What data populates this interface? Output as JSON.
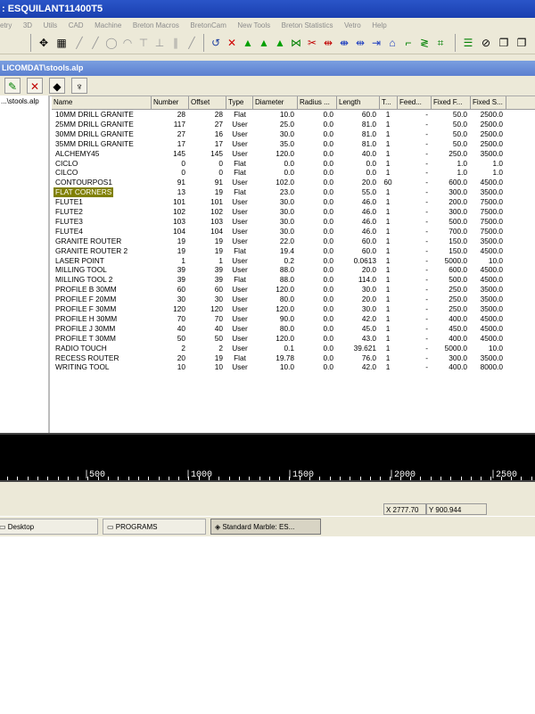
{
  "window": {
    "title": ": ESQUILANT11400T5"
  },
  "menu": [
    "etry",
    "3D",
    "Utils",
    "CAD",
    "Machine",
    "Breton Macros",
    "BretonCam",
    "New Tools",
    "Breton Statistics",
    "Vetro",
    "Help"
  ],
  "subwindow": {
    "title": "LICOMDAT\\stools.alp"
  },
  "tree": {
    "item": "...\\stools.alp"
  },
  "table": {
    "headers": [
      "Name",
      "Number",
      "Offset",
      "Type",
      "Diameter",
      "Radius ...",
      "Length",
      "T...",
      "Feed...",
      "Fixed F...",
      "Fixed S..."
    ],
    "rows": [
      [
        "10MM DRILL GRANITE",
        "28",
        "28",
        "Flat",
        "10.0",
        "0.0",
        "60.0",
        "1",
        "-",
        "50.0",
        "2500.0"
      ],
      [
        "25MM DRILL GRANITE",
        "117",
        "27",
        "User",
        "25.0",
        "0.0",
        "81.0",
        "1",
        "-",
        "50.0",
        "2500.0"
      ],
      [
        "30MM DRILL GRANITE",
        "27",
        "16",
        "User",
        "30.0",
        "0.0",
        "81.0",
        "1",
        "-",
        "50.0",
        "2500.0"
      ],
      [
        "35MM DRILL GRANITE",
        "17",
        "17",
        "User",
        "35.0",
        "0.0",
        "81.0",
        "1",
        "-",
        "50.0",
        "2500.0"
      ],
      [
        "ALCHEMY45",
        "145",
        "145",
        "User",
        "120.0",
        "0.0",
        "40.0",
        "1",
        "-",
        "250.0",
        "3500.0"
      ],
      [
        "CICLO",
        "0",
        "0",
        "Flat",
        "0.0",
        "0.0",
        "0.0",
        "1",
        "-",
        "1.0",
        "1.0"
      ],
      [
        "CILCO",
        "0",
        "0",
        "Flat",
        "0.0",
        "0.0",
        "0.0",
        "1",
        "-",
        "1.0",
        "1.0"
      ],
      [
        "CONTOURPOS1",
        "91",
        "91",
        "User",
        "102.0",
        "0.0",
        "20.0",
        "60",
        "-",
        "600.0",
        "4500.0"
      ],
      [
        "FLAT CORNERS",
        "13",
        "19",
        "Flat",
        "23.0",
        "0.0",
        "55.0",
        "1",
        "-",
        "300.0",
        "3500.0"
      ],
      [
        "FLUTE1",
        "101",
        "101",
        "User",
        "30.0",
        "0.0",
        "46.0",
        "1",
        "-",
        "200.0",
        "7500.0"
      ],
      [
        "FLUTE2",
        "102",
        "102",
        "User",
        "30.0",
        "0.0",
        "46.0",
        "1",
        "-",
        "300.0",
        "7500.0"
      ],
      [
        "FLUTE3",
        "103",
        "103",
        "User",
        "30.0",
        "0.0",
        "46.0",
        "1",
        "-",
        "500.0",
        "7500.0"
      ],
      [
        "FLUTE4",
        "104",
        "104",
        "User",
        "30.0",
        "0.0",
        "46.0",
        "1",
        "-",
        "700.0",
        "7500.0"
      ],
      [
        "GRANITE ROUTER",
        "19",
        "19",
        "User",
        "22.0",
        "0.0",
        "60.0",
        "1",
        "-",
        "150.0",
        "3500.0"
      ],
      [
        "GRANITE ROUTER 2",
        "19",
        "19",
        "Flat",
        "19.4",
        "0.0",
        "60.0",
        "1",
        "-",
        "150.0",
        "4500.0"
      ],
      [
        "LASER POINT",
        "1",
        "1",
        "User",
        "0.2",
        "0.0",
        "0.0613",
        "1",
        "-",
        "5000.0",
        "10.0"
      ],
      [
        "MILLING TOOL",
        "39",
        "39",
        "User",
        "88.0",
        "0.0",
        "20.0",
        "1",
        "-",
        "600.0",
        "4500.0"
      ],
      [
        "MILLING TOOL 2",
        "39",
        "39",
        "Flat",
        "88.0",
        "0.0",
        "114.0",
        "1",
        "-",
        "500.0",
        "4500.0"
      ],
      [
        "PROFILE B 30MM",
        "60",
        "60",
        "User",
        "120.0",
        "0.0",
        "30.0",
        "1",
        "-",
        "250.0",
        "3500.0"
      ],
      [
        "PROFILE F 20MM",
        "30",
        "30",
        "User",
        "80.0",
        "0.0",
        "20.0",
        "1",
        "-",
        "250.0",
        "3500.0"
      ],
      [
        "PROFILE F 30MM",
        "120",
        "120",
        "User",
        "120.0",
        "0.0",
        "30.0",
        "1",
        "-",
        "250.0",
        "3500.0"
      ],
      [
        "PROFILE H 30MM",
        "70",
        "70",
        "User",
        "90.0",
        "0.0",
        "42.0",
        "1",
        "-",
        "400.0",
        "4500.0"
      ],
      [
        "PROFILE J 30MM",
        "40",
        "40",
        "User",
        "80.0",
        "0.0",
        "45.0",
        "1",
        "-",
        "450.0",
        "4500.0"
      ],
      [
        "PROFILE T 30MM",
        "50",
        "50",
        "User",
        "120.0",
        "0.0",
        "43.0",
        "1",
        "-",
        "400.0",
        "4500.0"
      ],
      [
        "RADIO TOUCH",
        "2",
        "2",
        "User",
        "0.1",
        "0.0",
        "39.621",
        "1",
        "-",
        "5000.0",
        "10.0"
      ],
      [
        "RECESS ROUTER",
        "20",
        "19",
        "Flat",
        "19.78",
        "0.0",
        "76.0",
        "1",
        "-",
        "300.0",
        "3500.0"
      ],
      [
        "WRITING TOOL",
        "10",
        "10",
        "User",
        "10.0",
        "0.0",
        "42.0",
        "1",
        "-",
        "400.0",
        "8000.0"
      ]
    ],
    "selected_row_index": 8
  },
  "ruler": {
    "labels": [
      "|500",
      "|1000",
      "|1500",
      "|2000",
      "|2500"
    ]
  },
  "status": {
    "x": "X 2777.70",
    "y": "Y 900.944"
  },
  "taskbar": {
    "items": [
      "Desktop",
      "PROGRAMS",
      "Standard Marble: ES..."
    ],
    "active_index": 2
  },
  "icons": {
    "main_toolbar": [
      "move-icon",
      "grid-icon",
      "line-icon",
      "line-icon",
      "circle-icon",
      "arc-icon",
      "dimension-icon",
      "perpendicular-icon",
      "parallel-icon",
      "line-icon",
      "undo-icon",
      "delete-icon",
      "up-arrow-icon",
      "up-arrow-icon",
      "up-arrow-icon",
      "mirror-icon",
      "cut-icon",
      "join-icon",
      "split-icon",
      "split-icon",
      "offset-icon",
      "curve-icon",
      "zigzag-icon",
      "node-icon",
      "layers-icon",
      "hatch-icon",
      "window-icon",
      "window-icon"
    ]
  }
}
